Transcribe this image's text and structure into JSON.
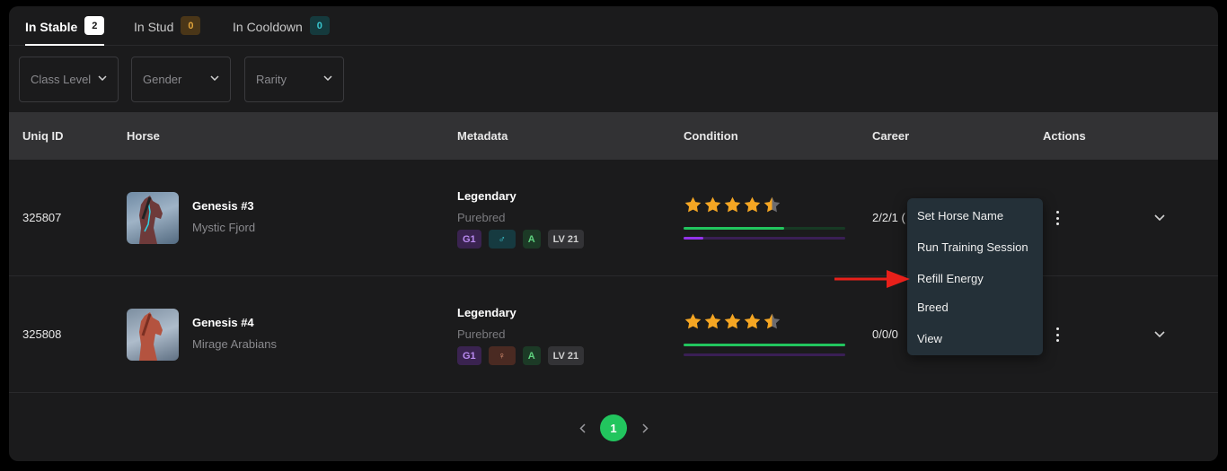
{
  "tabs": [
    {
      "label": "In Stable",
      "count": "2"
    },
    {
      "label": "In Stud",
      "count": "0"
    },
    {
      "label": "In Cooldown",
      "count": "0"
    }
  ],
  "filters": [
    {
      "placeholder": "Class Level"
    },
    {
      "placeholder": "Gender"
    },
    {
      "placeholder": "Rarity"
    }
  ],
  "table": {
    "headers": [
      "Uniq ID",
      "Horse",
      "Metadata",
      "Condition",
      "Career",
      "Actions"
    ],
    "rows": [
      {
        "uid": "325807",
        "name": "Genesis #3",
        "breed": "Mystic Fjord",
        "rarity": "Legendary",
        "bloodline": "Purebred",
        "generation": "G1",
        "gender_icon": "male-icon",
        "grade": "A",
        "level": "LV 21",
        "stars": 4.5,
        "condition_health": 0.62,
        "condition_energy": 0.12,
        "career": "2/2/1 ("
      },
      {
        "uid": "325808",
        "name": "Genesis #4",
        "breed": "Mirage Arabians",
        "rarity": "Legendary",
        "bloodline": "Purebred",
        "generation": "G1",
        "gender_icon": "female-icon",
        "grade": "A",
        "level": "LV 21",
        "stars": 4.5,
        "condition_health": 1.0,
        "condition_energy": 0.0,
        "career": "0/0/0"
      }
    ]
  },
  "actions_menu": {
    "items": [
      "Set Horse Name",
      "Run Training Session",
      "Refill Energy",
      "Breed",
      "View"
    ]
  },
  "pagination": {
    "current": "1"
  },
  "colors": {
    "accent_green": "#22c55e",
    "energy_purple": "#9333ea",
    "star": "#f5a623",
    "annotation_arrow": "#e8201a"
  }
}
